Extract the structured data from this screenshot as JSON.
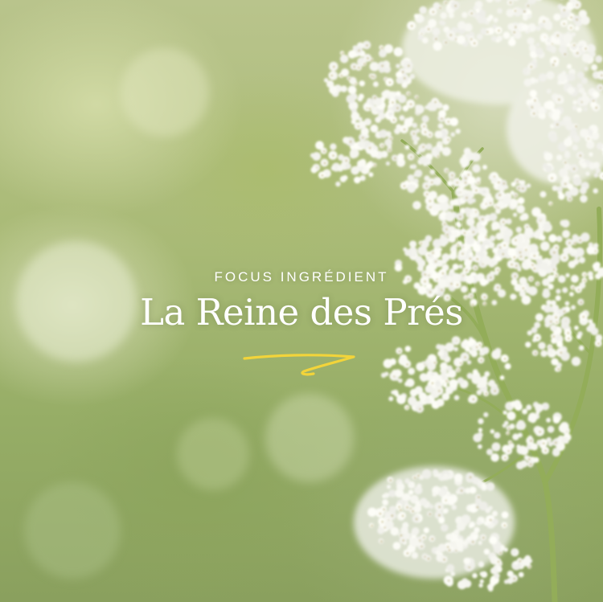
{
  "kicker": "FOCUS INGRÉDIENT",
  "title": "La Reine des Prés",
  "colors": {
    "text": "#ffffff",
    "accent": "#f2d43a",
    "background": "#a9ba76"
  }
}
